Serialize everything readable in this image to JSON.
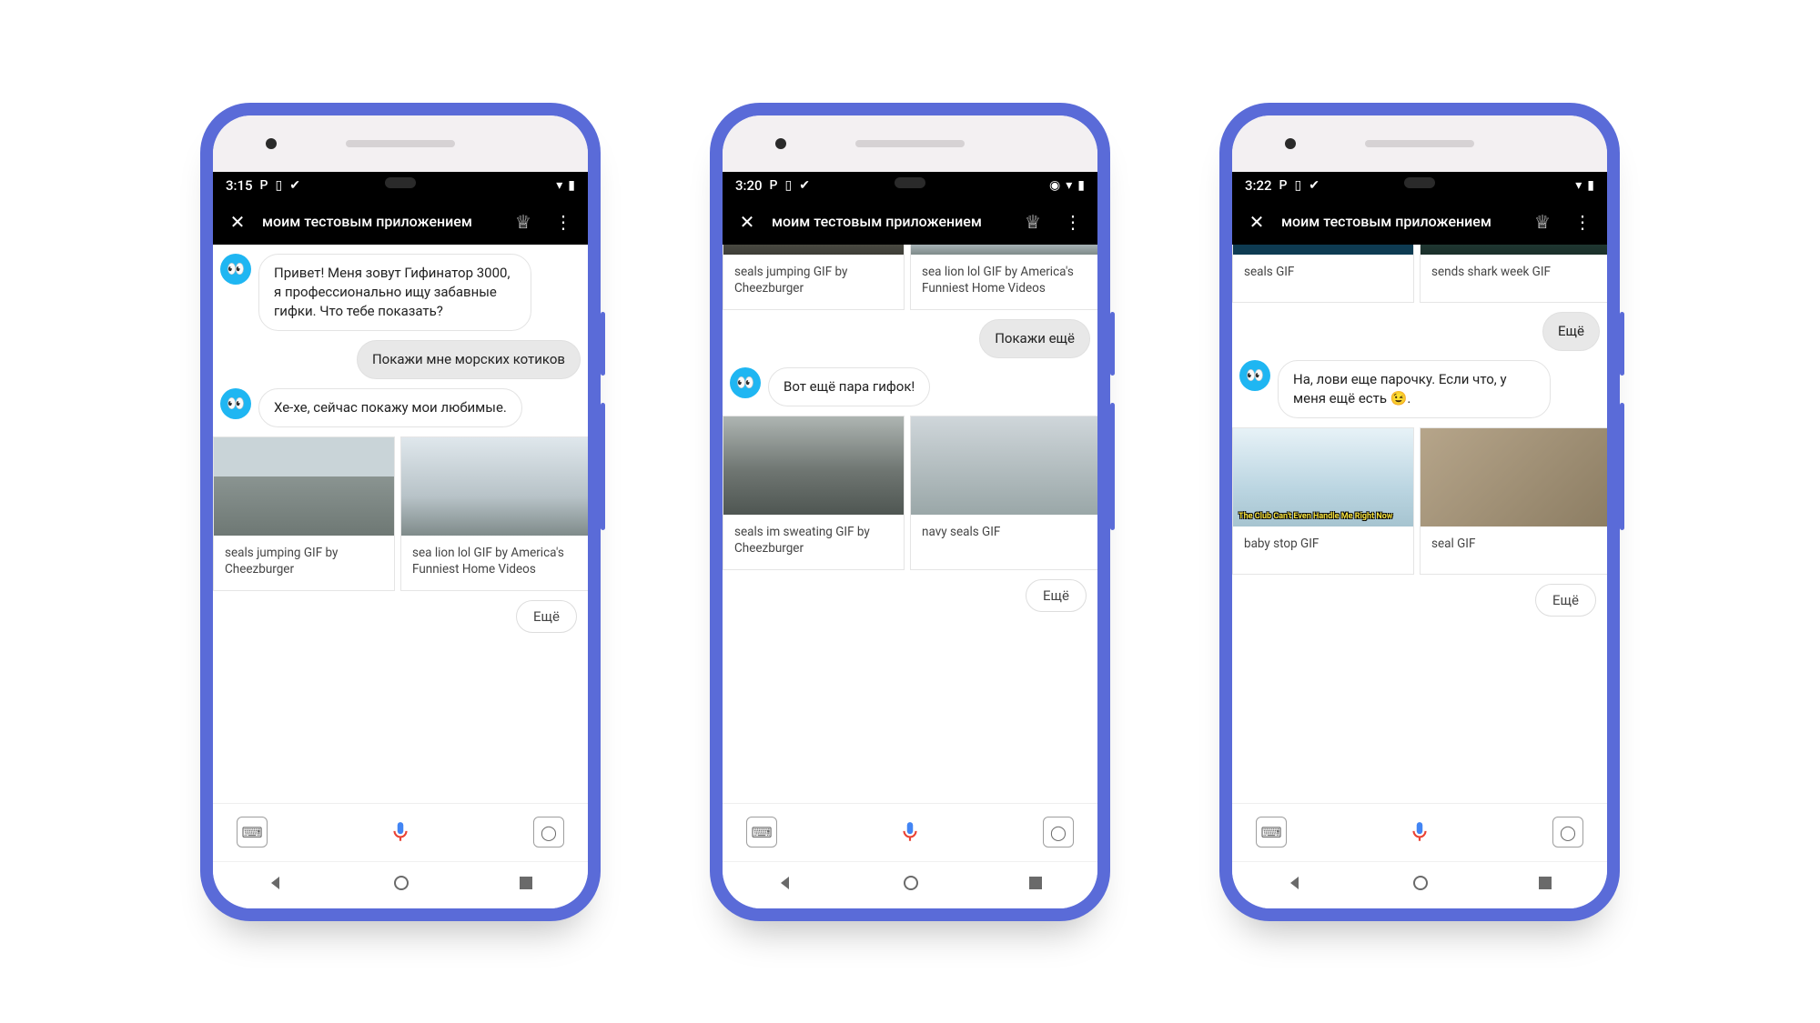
{
  "phones": [
    {
      "status_time": "3:15",
      "status_icons_left": [
        "P",
        "▯",
        "✔"
      ],
      "status_icons_right": [
        "▾",
        "▮"
      ],
      "app_title": "моим тестовым приложением",
      "bot_intro": "Привет! Меня зовут Гифинатор 3000, я профессионально ищу забавные гифки. Что тебе показать?",
      "user_msg": "Покажи мне морских котиков",
      "bot_reply": "Хе-хе, сейчас покажу мои любимые.",
      "cards": [
        {
          "caption": "seals jumping GIF by Cheezburger",
          "imgclass": "seal1"
        },
        {
          "caption": "sea lion lol GIF by America's Funniest Home Videos",
          "imgclass": "seal2"
        }
      ],
      "chip": "Ещё"
    },
    {
      "status_time": "3:20",
      "status_icons_left": [
        "P",
        "▯",
        "✔"
      ],
      "status_icons_right": [
        "◉",
        "▾",
        "▮"
      ],
      "app_title": "моим тестовым приложением",
      "top_cards": [
        {
          "caption": "seals jumping GIF by Cheezburger",
          "imgclass": "seal8"
        },
        {
          "caption": "sea lion lol GIF by America's Funniest Home Videos",
          "imgclass": "seal2"
        }
      ],
      "user_msg": "Покажи ещё",
      "bot_reply": "Вот ещё пара гифок!",
      "cards": [
        {
          "caption": "seals im sweating GIF by Cheezburger",
          "imgclass": "seal3"
        },
        {
          "caption": "navy seals GIF",
          "imgclass": "seal4"
        }
      ],
      "chip": "Ещё"
    },
    {
      "status_time": "3:22",
      "status_icons_left": [
        "P",
        "▯",
        "✔"
      ],
      "status_icons_right": [
        "▾",
        "▮"
      ],
      "app_title": "моим тестовым приложением",
      "top_cards": [
        {
          "caption": "seals GIF",
          "imgclass": "seal5"
        },
        {
          "caption": "sends shark week GIF",
          "imgclass": "seal9"
        }
      ],
      "user_msg": "Ещё",
      "bot_reply": "На, лови еще парочку. Если что, у меня ещё есть 😉.",
      "cards": [
        {
          "caption": "baby stop GIF",
          "imgclass": "seal6",
          "overlay": "The Club Can't Even Handle Me Right Now"
        },
        {
          "caption": "seal GIF",
          "imgclass": "seal7"
        }
      ],
      "chip": "Ещё"
    }
  ]
}
